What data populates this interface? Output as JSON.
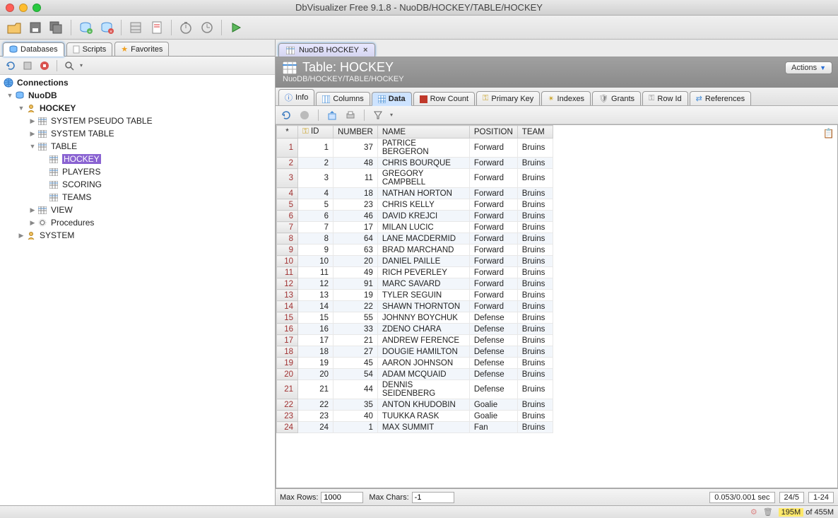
{
  "window": {
    "title": "DbVisualizer Free 9.1.8 - NuoDB/HOCKEY/TABLE/HOCKEY"
  },
  "left_tabs": {
    "databases": "Databases",
    "scripts": "Scripts",
    "favorites": "Favorites"
  },
  "tree": {
    "root": "Connections",
    "nuodb": "NuoDB",
    "hockey_schema": "HOCKEY",
    "sys_pseudo": "SYSTEM PSEUDO TABLE",
    "sys_table": "SYSTEM TABLE",
    "table": "TABLE",
    "hockey_tbl": "HOCKEY",
    "players": "PLAYERS",
    "scoring": "SCORING",
    "teams": "TEAMS",
    "view": "VIEW",
    "procedures": "Procedures",
    "system": "SYSTEM"
  },
  "doc_tab": {
    "label": "NuoDB HOCKEY"
  },
  "header": {
    "title": "Table: HOCKEY",
    "breadcrumb": "NuoDB/HOCKEY/TABLE/HOCKEY",
    "actions": "Actions"
  },
  "subtabs": {
    "info": "Info",
    "columns": "Columns",
    "data": "Data",
    "rowcount": "Row Count",
    "primarykey": "Primary Key",
    "indexes": "Indexes",
    "grants": "Grants",
    "rowid": "Row Id",
    "references": "References"
  },
  "grid": {
    "columns": {
      "id": "ID",
      "number": "NUMBER",
      "name": "NAME",
      "position": "POSITION",
      "team": "TEAM"
    },
    "rows": [
      {
        "n": "1",
        "id": "1",
        "number": "37",
        "name": "PATRICE BERGERON",
        "position": "Forward",
        "team": "Bruins"
      },
      {
        "n": "2",
        "id": "2",
        "number": "48",
        "name": "CHRIS BOURQUE",
        "position": "Forward",
        "team": "Bruins"
      },
      {
        "n": "3",
        "id": "3",
        "number": "11",
        "name": "GREGORY CAMPBELL",
        "position": "Forward",
        "team": "Bruins"
      },
      {
        "n": "4",
        "id": "4",
        "number": "18",
        "name": "NATHAN HORTON",
        "position": "Forward",
        "team": "Bruins"
      },
      {
        "n": "5",
        "id": "5",
        "number": "23",
        "name": "CHRIS KELLY",
        "position": "Forward",
        "team": "Bruins"
      },
      {
        "n": "6",
        "id": "6",
        "number": "46",
        "name": "DAVID KREJCI",
        "position": "Forward",
        "team": "Bruins"
      },
      {
        "n": "7",
        "id": "7",
        "number": "17",
        "name": "MILAN LUCIC",
        "position": "Forward",
        "team": "Bruins"
      },
      {
        "n": "8",
        "id": "8",
        "number": "64",
        "name": "LANE MACDERMID",
        "position": "Forward",
        "team": "Bruins"
      },
      {
        "n": "9",
        "id": "9",
        "number": "63",
        "name": "BRAD MARCHAND",
        "position": "Forward",
        "team": "Bruins"
      },
      {
        "n": "10",
        "id": "10",
        "number": "20",
        "name": "DANIEL PAILLE",
        "position": "Forward",
        "team": "Bruins"
      },
      {
        "n": "11",
        "id": "11",
        "number": "49",
        "name": "RICH PEVERLEY",
        "position": "Forward",
        "team": "Bruins"
      },
      {
        "n": "12",
        "id": "12",
        "number": "91",
        "name": "MARC SAVARD",
        "position": "Forward",
        "team": "Bruins"
      },
      {
        "n": "13",
        "id": "13",
        "number": "19",
        "name": "TYLER SEGUIN",
        "position": "Forward",
        "team": "Bruins"
      },
      {
        "n": "14",
        "id": "14",
        "number": "22",
        "name": "SHAWN THORNTON",
        "position": "Forward",
        "team": "Bruins"
      },
      {
        "n": "15",
        "id": "15",
        "number": "55",
        "name": "JOHNNY BOYCHUK",
        "position": "Defense",
        "team": "Bruins"
      },
      {
        "n": "16",
        "id": "16",
        "number": "33",
        "name": "ZDENO CHARA",
        "position": "Defense",
        "team": "Bruins"
      },
      {
        "n": "17",
        "id": "17",
        "number": "21",
        "name": "ANDREW FERENCE",
        "position": "Defense",
        "team": "Bruins"
      },
      {
        "n": "18",
        "id": "18",
        "number": "27",
        "name": "DOUGIE HAMILTON",
        "position": "Defense",
        "team": "Bruins"
      },
      {
        "n": "19",
        "id": "19",
        "number": "45",
        "name": "AARON JOHNSON",
        "position": "Defense",
        "team": "Bruins"
      },
      {
        "n": "20",
        "id": "20",
        "number": "54",
        "name": "ADAM MCQUAID",
        "position": "Defense",
        "team": "Bruins"
      },
      {
        "n": "21",
        "id": "21",
        "number": "44",
        "name": "DENNIS SEIDENBERG",
        "position": "Defense",
        "team": "Bruins"
      },
      {
        "n": "22",
        "id": "22",
        "number": "35",
        "name": "ANTON KHUDOBIN",
        "position": "Goalie",
        "team": "Bruins"
      },
      {
        "n": "23",
        "id": "23",
        "number": "40",
        "name": "TUUKKA RASK",
        "position": "Goalie",
        "team": "Bruins"
      },
      {
        "n": "24",
        "id": "24",
        "number": "1",
        "name": "MAX SUMMIT",
        "position": "Fan",
        "team": "Bruins"
      }
    ]
  },
  "gridstatus": {
    "maxrows_label": "Max Rows:",
    "maxrows_value": "1000",
    "maxchars_label": "Max Chars:",
    "maxchars_value": "-1",
    "timing": "0.053/0.001 sec",
    "counts": "24/5",
    "range": "1-24"
  },
  "appstatus": {
    "mem_used": "195M",
    "mem_total": " of 455M"
  }
}
